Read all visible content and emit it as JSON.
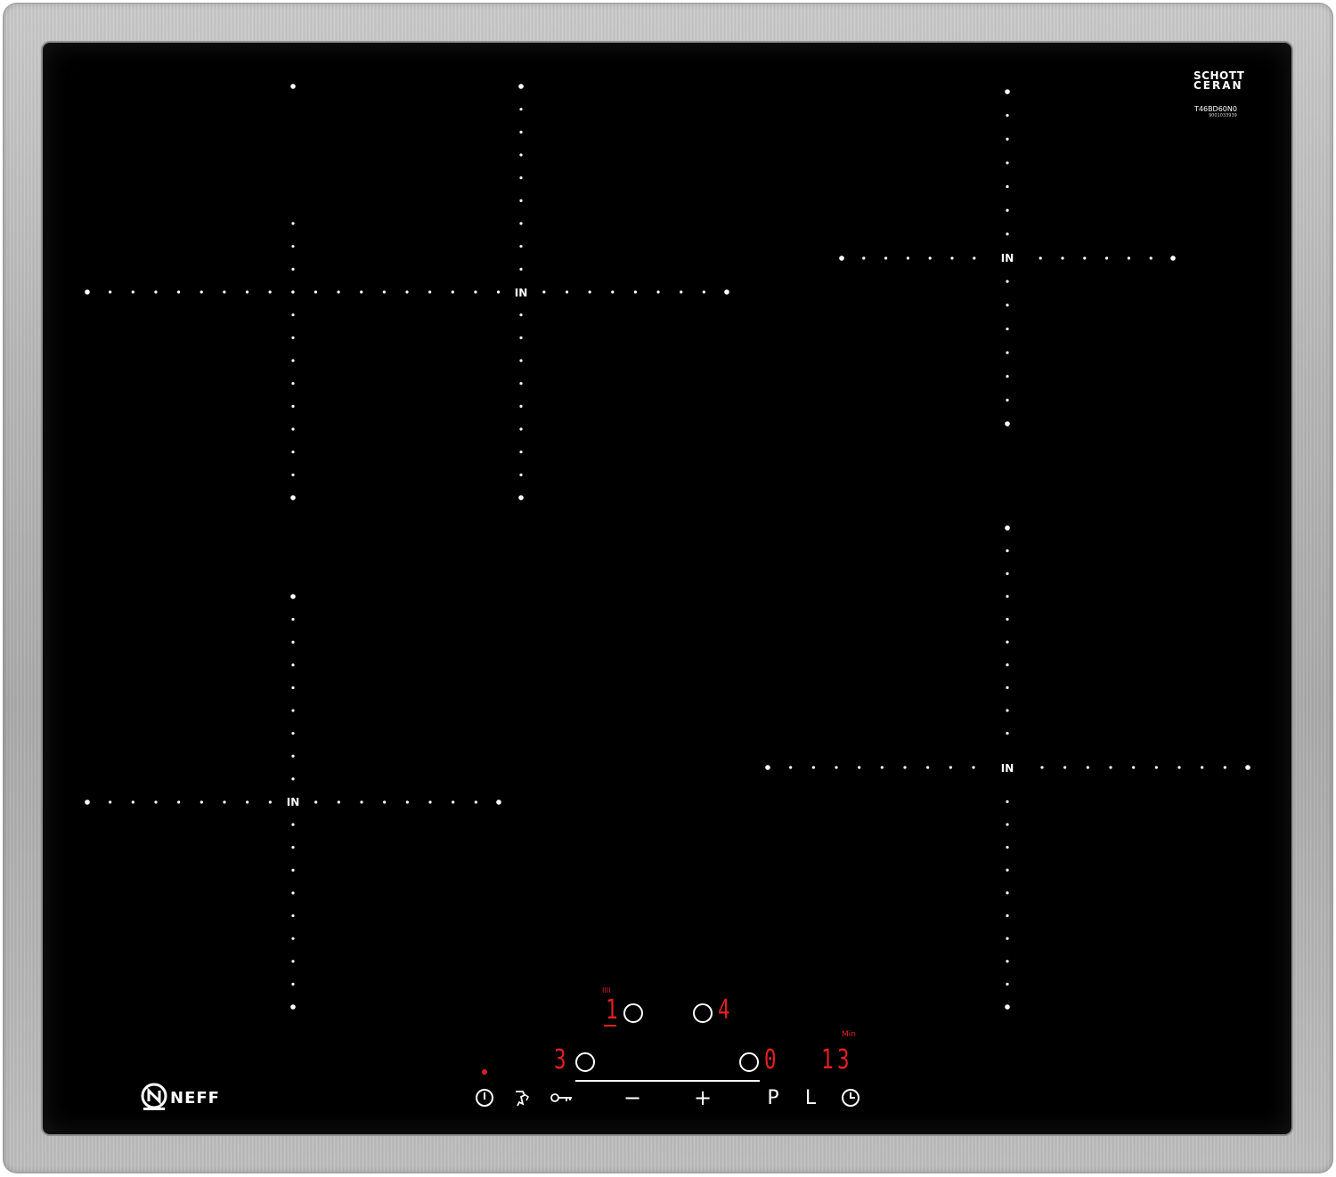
{
  "brand": {
    "name": "NEFF",
    "glass_maker_line1": "SCHOTT",
    "glass_maker_line2": "CERAN",
    "model": "T46BD60N0",
    "serial": "9001033939"
  },
  "zones": {
    "marker_label": "IN",
    "front_left_marker": "IN",
    "rear_left_marker": "IN",
    "rear_right_marker": "IN",
    "front_right_marker": "IN"
  },
  "display": {
    "top_left_value": "1",
    "top_left_tag": "IIII",
    "top_right_value": "4",
    "bottom_left_value": "3",
    "bottom_right_value": "0",
    "timer_value": "13",
    "timer_unit": "Min"
  },
  "controls": {
    "minus": "−",
    "plus": "+",
    "p_label": "P",
    "l_label": "L"
  },
  "colors": {
    "glass": "#000000",
    "frame": "#b8b8b8",
    "display": "#e02020",
    "markings": "#ffffff"
  },
  "icons": [
    "power-icon",
    "child-lock-icon",
    "key-icon",
    "clock-icon",
    "status-dot-icon"
  ]
}
